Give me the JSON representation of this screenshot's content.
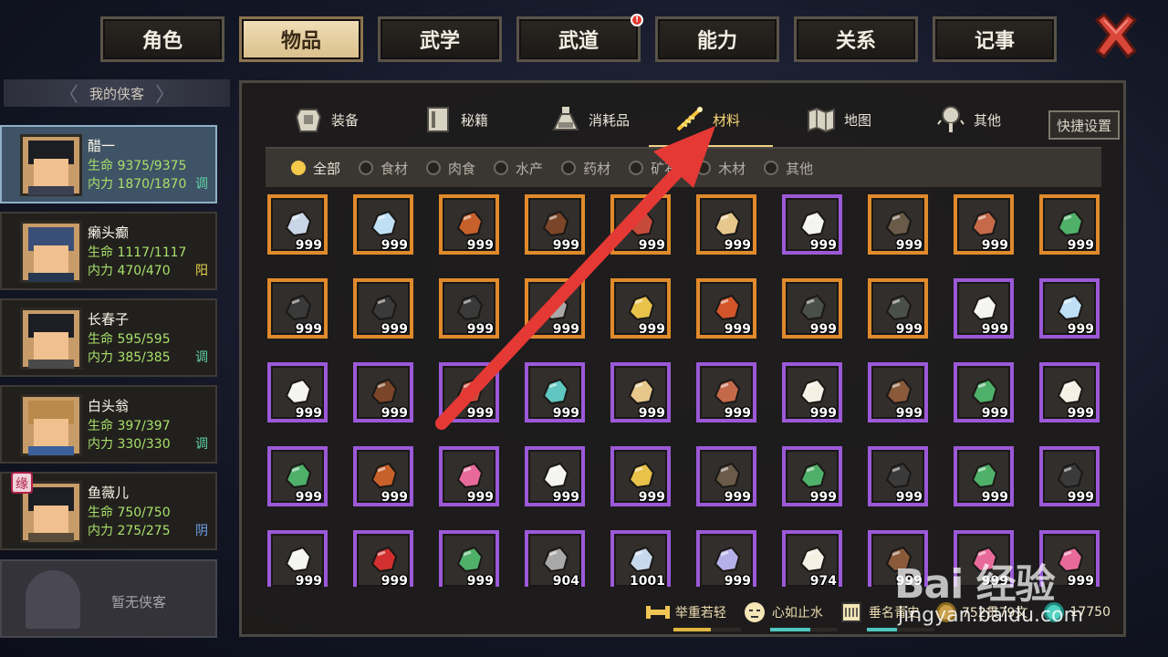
{
  "top_tabs": [
    {
      "label": "角色",
      "active": false
    },
    {
      "label": "物品",
      "active": true
    },
    {
      "label": "武学",
      "active": false
    },
    {
      "label": "武道",
      "active": false,
      "badge": "!"
    },
    {
      "label": "能力",
      "active": false
    },
    {
      "label": "关系",
      "active": false
    },
    {
      "label": "记事",
      "active": false
    }
  ],
  "roster": {
    "title": "我的侠客",
    "heroes": [
      {
        "name": "醋一",
        "hp_label": "生命",
        "hp": "9375/9375",
        "mp_label": "内力",
        "mp": "1870/1870",
        "tag": "调",
        "tag_color": "#5fd3a8",
        "active": true
      },
      {
        "name": "癞头癫",
        "hp_label": "生命",
        "hp": "1117/1117",
        "mp_label": "内力",
        "mp": "470/470",
        "tag": "阳",
        "tag_color": "#e8d24a",
        "active": false
      },
      {
        "name": "长春子",
        "hp_label": "生命",
        "hp": "595/595",
        "mp_label": "内力",
        "mp": "385/385",
        "tag": "调",
        "tag_color": "#5fd3a8",
        "active": false
      },
      {
        "name": "白头翁",
        "hp_label": "生命",
        "hp": "397/397",
        "mp_label": "内力",
        "mp": "330/330",
        "tag": "调",
        "tag_color": "#5fd3a8",
        "active": false
      },
      {
        "name": "鱼薇儿",
        "hp_label": "生命",
        "hp": "750/750",
        "mp_label": "内力",
        "mp": "275/275",
        "tag": "阴",
        "tag_color": "#6fa0e8",
        "active": false,
        "fate_badge": "缘"
      }
    ],
    "empty_slot_label": "暂无侠客"
  },
  "categories": [
    {
      "label": "装备",
      "icon": "armor-icon",
      "active": false
    },
    {
      "label": "秘籍",
      "icon": "book-icon",
      "active": false
    },
    {
      "label": "消耗品",
      "icon": "potion-icon",
      "active": false
    },
    {
      "label": "材料",
      "icon": "materials-icon",
      "active": true
    },
    {
      "label": "地图",
      "icon": "map-icon",
      "active": false
    },
    {
      "label": "其他",
      "icon": "lantern-icon",
      "active": false
    }
  ],
  "quick_settings_label": "快捷设置",
  "filters": [
    {
      "label": "全部",
      "active": true
    },
    {
      "label": "食材",
      "active": false
    },
    {
      "label": "肉食",
      "active": false
    },
    {
      "label": "水产",
      "active": false
    },
    {
      "label": "药材",
      "active": false
    },
    {
      "label": "矿石",
      "active": false
    },
    {
      "label": "木材",
      "active": false
    },
    {
      "label": "其他",
      "active": false
    }
  ],
  "items": [
    {
      "icon": "fish-icon",
      "qty": "999",
      "rarity": "orange"
    },
    {
      "icon": "ice-block-icon",
      "qty": "999",
      "rarity": "orange"
    },
    {
      "icon": "mushroom-icon",
      "qty": "999",
      "rarity": "orange"
    },
    {
      "icon": "meat-chunk-icon",
      "qty": "999",
      "rarity": "orange"
    },
    {
      "icon": "raw-meat-icon",
      "qty": "999",
      "rarity": "orange"
    },
    {
      "icon": "roots-icon",
      "qty": "999",
      "rarity": "orange"
    },
    {
      "icon": "white-flowers-icon",
      "qty": "999",
      "rarity": "purple"
    },
    {
      "icon": "branches-icon",
      "qty": "999",
      "rarity": "orange"
    },
    {
      "icon": "ore-cluster-icon",
      "qty": "999",
      "rarity": "orange"
    },
    {
      "icon": "green-worm-icon",
      "qty": "999",
      "rarity": "orange"
    },
    {
      "icon": "centipede-icon",
      "qty": "999",
      "rarity": "orange"
    },
    {
      "icon": "cockroach-icon",
      "qty": "999",
      "rarity": "orange"
    },
    {
      "icon": "beetle-icon",
      "qty": "999",
      "rarity": "orange"
    },
    {
      "icon": "dark-ore-icon",
      "qty": "999",
      "rarity": "orange"
    },
    {
      "icon": "gold-nugget-icon",
      "qty": "999",
      "rarity": "orange"
    },
    {
      "icon": "lava-rock-icon",
      "qty": "999",
      "rarity": "orange"
    },
    {
      "icon": "dark-wood-icon",
      "qty": "999",
      "rarity": "orange"
    },
    {
      "icon": "black-logs-icon",
      "qty": "999",
      "rarity": "orange"
    },
    {
      "icon": "salt-pile-icon",
      "qty": "999",
      "rarity": "purple"
    },
    {
      "icon": "rice-pile-icon",
      "qty": "999",
      "rarity": "purple"
    },
    {
      "icon": "flour-pile-icon",
      "qty": "999",
      "rarity": "purple"
    },
    {
      "icon": "cooked-meat-icon",
      "qty": "999",
      "rarity": "purple"
    },
    {
      "icon": "red-meat-icon",
      "qty": "999",
      "rarity": "purple"
    },
    {
      "icon": "jade-leaf-icon",
      "qty": "999",
      "rarity": "purple"
    },
    {
      "icon": "ginseng-icon",
      "qty": "999",
      "rarity": "purple"
    },
    {
      "icon": "brown-stone-icon",
      "qty": "999",
      "rarity": "purple"
    },
    {
      "icon": "cream-stone-icon",
      "qty": "999",
      "rarity": "purple"
    },
    {
      "icon": "wood-planks-icon",
      "qty": "999",
      "rarity": "purple"
    },
    {
      "icon": "seaweed-icon",
      "qty": "999",
      "rarity": "purple"
    },
    {
      "icon": "lotus-icon",
      "qty": "999",
      "rarity": "purple"
    },
    {
      "icon": "herb-sprig-icon",
      "qty": "999",
      "rarity": "purple"
    },
    {
      "icon": "mushroom-cluster-icon",
      "qty": "999",
      "rarity": "purple"
    },
    {
      "icon": "pink-flower-icon",
      "qty": "999",
      "rarity": "purple"
    },
    {
      "icon": "white-lily-icon",
      "qty": "999",
      "rarity": "purple"
    },
    {
      "icon": "yellow-flower-icon",
      "qty": "999",
      "rarity": "purple"
    },
    {
      "icon": "lizard-icon",
      "qty": "999",
      "rarity": "purple"
    },
    {
      "icon": "green-beetle-icon",
      "qty": "999",
      "rarity": "purple"
    },
    {
      "icon": "dark-beetle-icon",
      "qty": "999",
      "rarity": "purple"
    },
    {
      "icon": "green-herb-icon",
      "qty": "999",
      "rarity": "purple"
    },
    {
      "icon": "black-beetle-icon",
      "qty": "999",
      "rarity": "purple"
    },
    {
      "icon": "white-blossom-icon",
      "qty": "999",
      "rarity": "purple"
    },
    {
      "icon": "red-rose-icon",
      "qty": "999",
      "rarity": "purple"
    },
    {
      "icon": "basil-icon",
      "qty": "999",
      "rarity": "purple"
    },
    {
      "icon": "grey-ore-icon",
      "qty": "904",
      "rarity": "purple"
    },
    {
      "icon": "silver-ore-icon",
      "qty": "1001",
      "rarity": "purple"
    },
    {
      "icon": "crystal-ore-icon",
      "qty": "999",
      "rarity": "purple"
    },
    {
      "icon": "pearl-icon",
      "qty": "974",
      "rarity": "purple"
    },
    {
      "icon": "log-icon",
      "qty": "999",
      "rarity": "purple"
    },
    {
      "icon": "pink-wood-icon",
      "qty": "999",
      "rarity": "purple"
    },
    {
      "icon": "pink-log-icon",
      "qty": "999",
      "rarity": "purple"
    }
  ],
  "status": [
    {
      "label": "举重若轻",
      "icon": "strength-icon",
      "bar_color": "#e0b640",
      "level": 0.55
    },
    {
      "label": "心如止水",
      "icon": "calm-face-icon",
      "bar_color": "#4fc7c0",
      "level": 0.6
    },
    {
      "label": "垂名青史",
      "icon": "scroll-icon",
      "bar_color": "#4fc7c0",
      "level": 0.45
    }
  ],
  "money": {
    "copper": "752贯79文",
    "jade": "17750"
  },
  "watermark": {
    "brand": "Bai 经验",
    "url": "jingyan.baidu.com"
  },
  "colors": {
    "rarity_orange": "#e08a2c",
    "rarity_purple": "#9b59d8",
    "accent_gold": "#f8d978",
    "active_card": "#3f5366",
    "arrow_red": "#e53935"
  }
}
